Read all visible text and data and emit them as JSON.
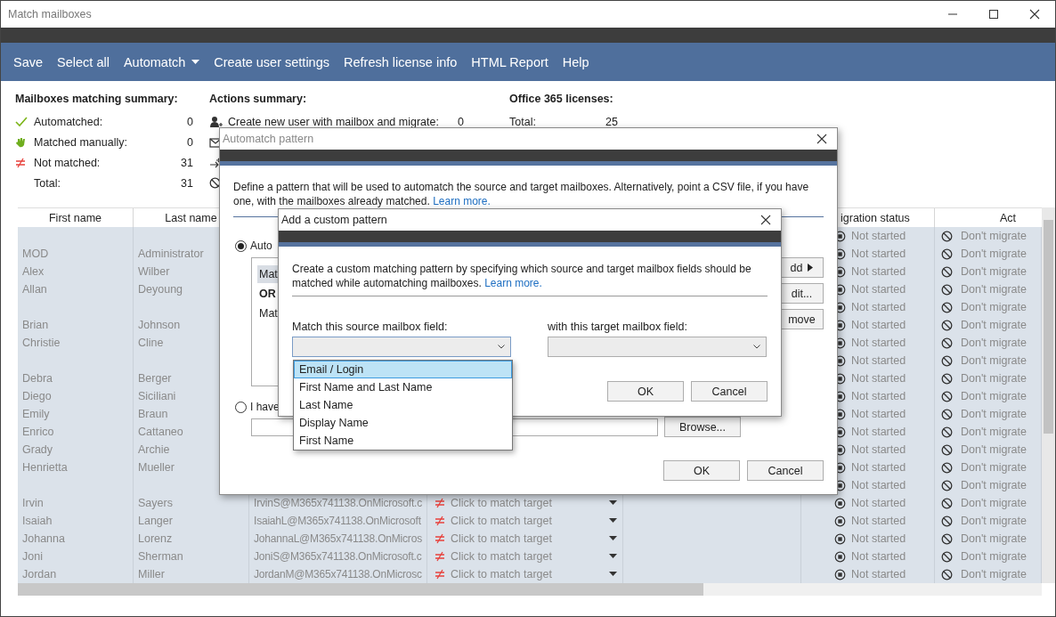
{
  "window": {
    "title": "Match mailboxes"
  },
  "menu": [
    {
      "label": "Save",
      "kind": "plain"
    },
    {
      "label": "Select all",
      "kind": "plain"
    },
    {
      "label": "Automatch",
      "kind": "dropdown"
    },
    {
      "label": "Create user settings",
      "kind": "plain"
    },
    {
      "label": "Refresh license info",
      "kind": "plain"
    },
    {
      "label": "HTML Report",
      "kind": "plain"
    },
    {
      "label": "Help",
      "kind": "plain"
    }
  ],
  "summary": {
    "matching": {
      "title": "Mailboxes matching summary:",
      "items": [
        {
          "kind": "automatched",
          "label": "Automatched:",
          "value": "0"
        },
        {
          "kind": "manual",
          "label": "Matched manually:",
          "value": "0"
        },
        {
          "kind": "not-matched",
          "label": "Not matched:",
          "value": "31"
        },
        {
          "kind": "total",
          "label": "Total:",
          "value": "31"
        }
      ]
    },
    "actions": {
      "title": "Actions summary:",
      "items": [
        {
          "kind": "create-user",
          "label": "Create new user with mailbox and migrate:",
          "value": "0"
        },
        {
          "kind": "mailbox"
        },
        {
          "kind": "move"
        },
        {
          "kind": "skip"
        }
      ]
    },
    "licenses": {
      "title": "Office 365 licenses:",
      "items": [
        {
          "label": "Total:",
          "value": "25"
        }
      ]
    }
  },
  "table": {
    "columns": {
      "first_name": "First name",
      "last_name": "Last name",
      "migration_status": "igration status",
      "action": "Act"
    },
    "rows": [
      {
        "status": "Not started",
        "action": "Don't migrate"
      },
      {
        "first_name": "MOD",
        "last_name": "Administrator",
        "status": "Not started",
        "action": "Don't migrate"
      },
      {
        "first_name": "Alex",
        "last_name": "Wilber",
        "status": "Not started",
        "action": "Don't migrate"
      },
      {
        "first_name": "Allan",
        "last_name": "Deyoung",
        "status": "Not started",
        "action": "Don't migrate"
      },
      {
        "status": "Not started",
        "action": "Don't migrate"
      },
      {
        "first_name": "Brian",
        "last_name": "Johnson",
        "status": "Not started",
        "action": "Don't migrate"
      },
      {
        "first_name": "Christie",
        "last_name": "Cline",
        "status": "Not started",
        "action": "Don't migrate"
      },
      {
        "status": "Not started",
        "action": "Don't migrate"
      },
      {
        "first_name": "Debra",
        "last_name": "Berger",
        "status": "Not started",
        "action": "Don't migrate"
      },
      {
        "first_name": "Diego",
        "last_name": "Siciliani",
        "status": "Not started",
        "action": "Don't migrate"
      },
      {
        "first_name": "Emily",
        "last_name": "Braun",
        "status": "Not started",
        "action": "Don't migrate"
      },
      {
        "first_name": "Enrico",
        "last_name": "Cattaneo",
        "status": "Not started",
        "action": "Don't migrate"
      },
      {
        "first_name": "Grady",
        "last_name": "Archie",
        "status": "Not started",
        "action": "Don't migrate"
      },
      {
        "first_name": "Henrietta",
        "last_name": "Mueller",
        "status": "Not started",
        "action": "Don't migrate"
      },
      {
        "status": "Not started",
        "action": "Don't migrate"
      },
      {
        "first_name": "Irvin",
        "last_name": "Sayers",
        "email": "IrvinS@M365x741138.OnMicrosoft.c",
        "target": "Click to match target",
        "status": "Not started",
        "action": "Don't migrate"
      },
      {
        "first_name": "Isaiah",
        "last_name": "Langer",
        "email": "IsaiahL@M365x741138.OnMicrosoft",
        "target": "Click to match target",
        "status": "Not started",
        "action": "Don't migrate"
      },
      {
        "first_name": "Johanna",
        "last_name": "Lorenz",
        "email": "JohannaL@M365x741138.OnMicros",
        "target": "Click to match target",
        "status": "Not started",
        "action": "Don't migrate"
      },
      {
        "first_name": "Joni",
        "last_name": "Sherman",
        "email": "JoniS@M365x741138.OnMicrosoft.c",
        "target": "Click to match target",
        "status": "Not started",
        "action": "Don't migrate"
      },
      {
        "first_name": "Jordan",
        "last_name": "Miller",
        "email": "JordanM@M365x741138.OnMicrosc",
        "target": "Click to match target",
        "status": "Not started",
        "action": "Don't migrate"
      }
    ]
  },
  "automatch_dialog": {
    "title": "Automatch pattern",
    "description": "Define a pattern that will be used to automatch the source and target mailboxes. Alternatively, point a CSV file, if you have one, with the mailboxes already matched.",
    "link": "Learn more.",
    "options": [
      {
        "label": "Auto",
        "selected": true
      },
      {
        "label": "I have",
        "selected": false
      }
    ],
    "patterns": [
      {
        "kind": "rule",
        "text": "Mat",
        "selected": true
      },
      {
        "kind": "operator",
        "text": "OR",
        "selected": false
      },
      {
        "kind": "rule",
        "text": "Mat",
        "selected": false
      }
    ],
    "side_buttons": [
      {
        "label": "dd",
        "kind": "arrow"
      },
      {
        "label": "dit...",
        "kind": "plain"
      },
      {
        "label": "move",
        "kind": "plain"
      }
    ],
    "browse": "Browse...",
    "buttons": [
      "OK",
      "Cancel"
    ]
  },
  "custom_dialog": {
    "title": "Add a custom pattern",
    "description": "Create a custom matching pattern by specifying which source and target mailbox fields should be matched while automatching mailboxes.",
    "link": "Learn more.",
    "source_label": "Match this source mailbox field:",
    "target_label": "with this target mailbox field:",
    "source_expanded": true,
    "source_options": [
      {
        "label": "Email / Login",
        "selected": true
      },
      {
        "label": "First Name and Last Name",
        "selected": false
      },
      {
        "label": "Last Name",
        "selected": false
      },
      {
        "label": "Display Name",
        "selected": false
      },
      {
        "label": "First Name",
        "selected": false
      }
    ],
    "buttons": [
      "OK",
      "Cancel"
    ]
  }
}
